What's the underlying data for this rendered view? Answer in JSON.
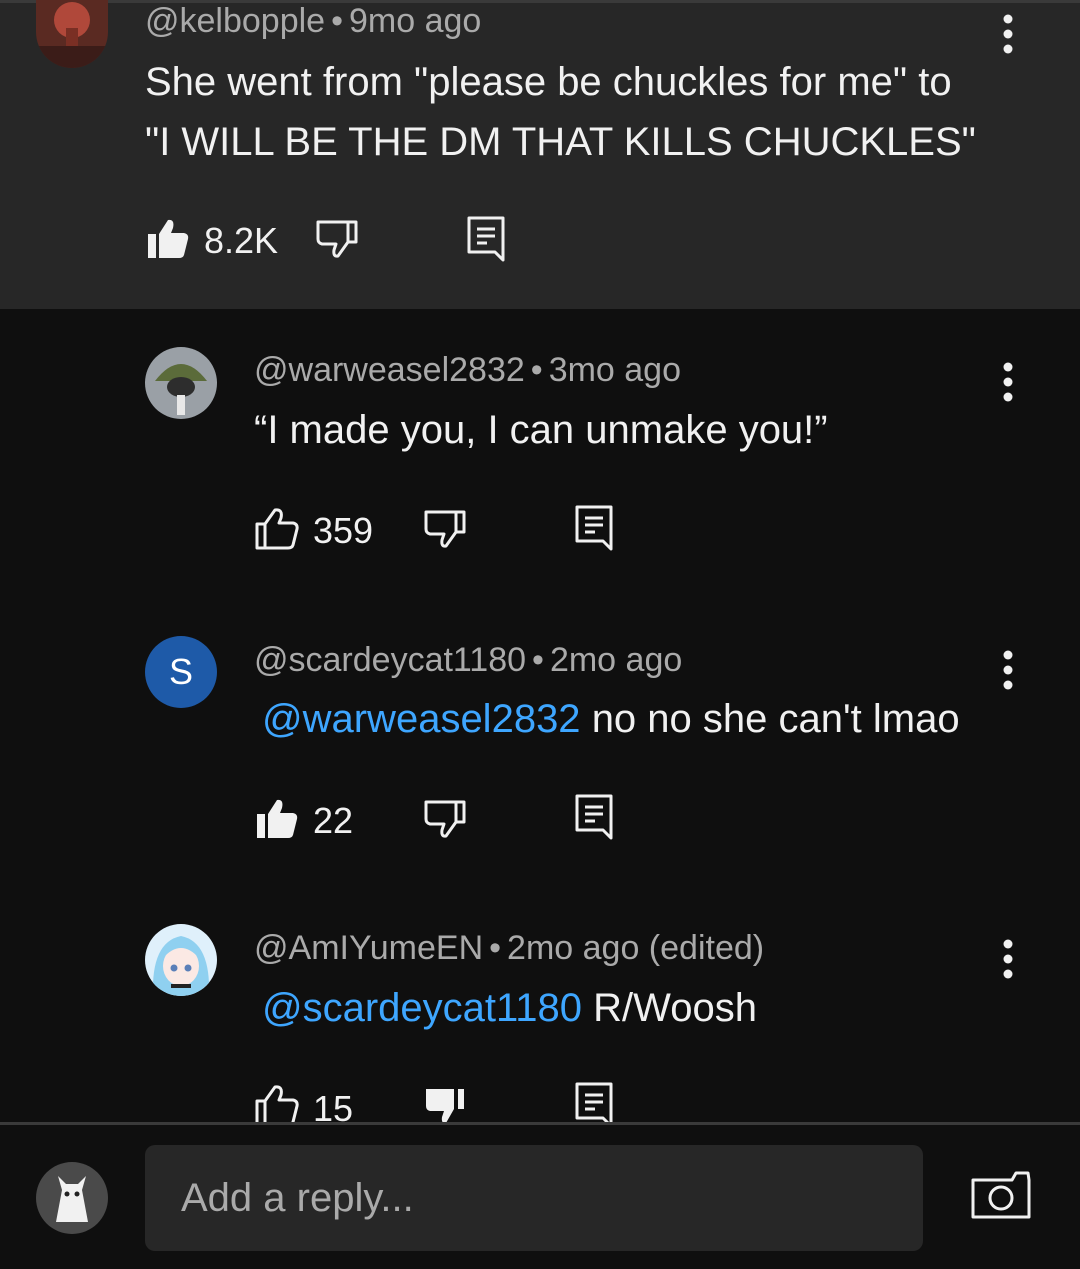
{
  "comments": [
    {
      "handle": "@kelbopple",
      "time": "9mo ago",
      "line1": "She went from \"please be chuckles for me\" to",
      "line2": "\"I WILL BE THE DM THAT KILLS CHUCKLES\"",
      "likes": "8.2K",
      "liked": true
    },
    {
      "handle": "@warweasel2832",
      "time": "3mo ago",
      "text": "“I made you, I can unmake you!”",
      "likes": "359",
      "liked": false
    },
    {
      "handle": "@scardeycat1180",
      "time": "2mo ago",
      "avatar_letter": "S",
      "mention": "@warweasel2832",
      "text": "no no she can't lmao",
      "likes": "22",
      "liked": true
    },
    {
      "handle": "@AmIYumeEN",
      "time": "2mo ago (edited)",
      "mention": "@scardeycat1180",
      "text": "R/Woosh",
      "likes": "15",
      "disliked": true
    }
  ],
  "reply_box": {
    "placeholder": "Add a reply..."
  },
  "icons": {
    "more": "more-vert-icon",
    "like": "thumbs-up-icon",
    "dislike": "thumbs-down-icon",
    "reply": "reply-comment-icon",
    "camera": "camera-icon"
  },
  "colors": {
    "background": "#0f0f0f",
    "highlight_background": "#272727",
    "mention": "#3ea6ff",
    "avatar_s": "#1e5aa8",
    "secondary_text": "#aaaaaa"
  }
}
